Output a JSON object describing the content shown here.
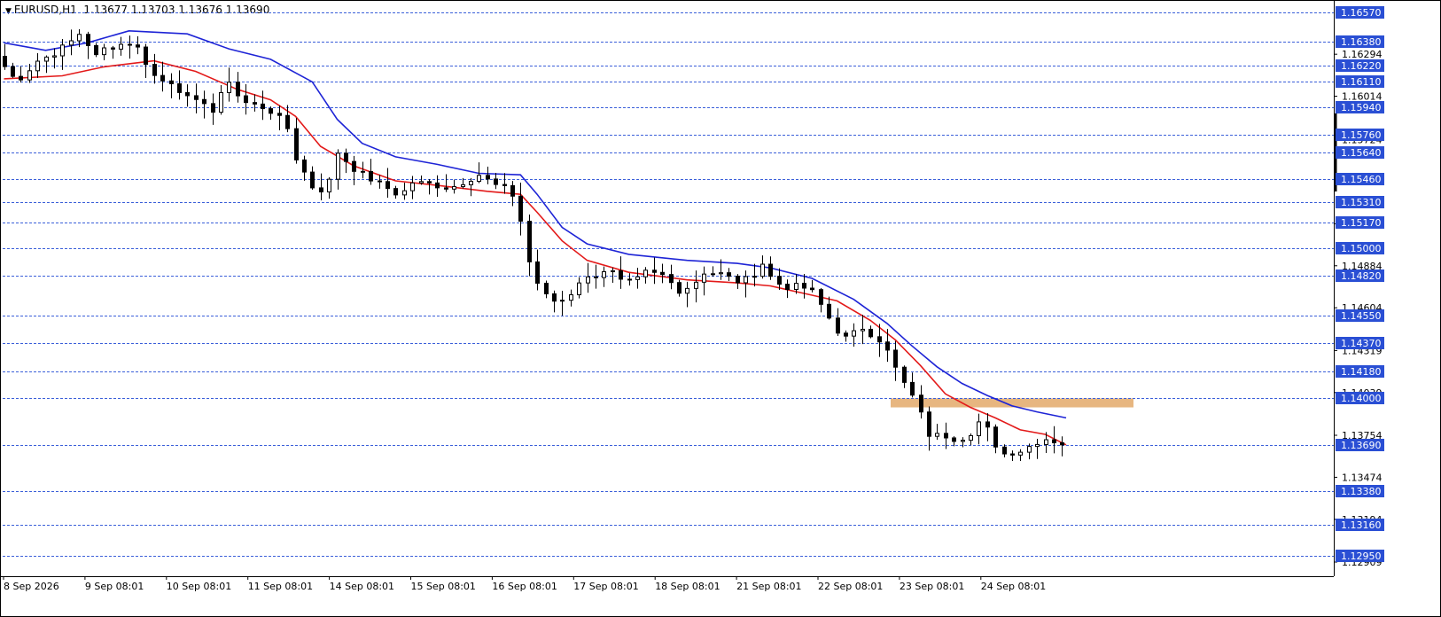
{
  "header": {
    "symbol": "EURUSD,H1",
    "ohlc": "1.13677 1.13703 1.13676 1.13690"
  },
  "colors": {
    "level_line": "#3b5fd9",
    "level_label_bg": "#2a4fd4",
    "ma_fast": "#e31a1a",
    "ma_slow": "#1e24d6",
    "candle": "#000000",
    "zone": "#e7b680"
  },
  "chart_data": {
    "type": "candlestick",
    "symbol": "EURUSD",
    "timeframe": "H1",
    "ylim": [
      1.1285,
      1.1662
    ],
    "horizontal_levels": [
      1.1657,
      1.1638,
      1.1622,
      1.1611,
      1.1594,
      1.1576,
      1.1564,
      1.1546,
      1.1531,
      1.1517,
      1.15,
      1.1482,
      1.1455,
      1.1437,
      1.1418,
      1.14,
      1.1369,
      1.1338,
      1.1316,
      1.1295
    ],
    "level_labels": [
      "1.16570",
      "1.16380",
      "1.16220",
      "1.16110",
      "1.15940",
      "1.15760",
      "1.15640",
      "1.15460",
      "1.15310",
      "1.15170",
      "1.15000",
      "1.14820",
      "1.14550",
      "1.14370",
      "1.14180",
      "1.14000",
      "1.13690",
      "1.13380",
      "1.13160",
      "1.12950"
    ],
    "price_scale_ticks": [
      {
        "value": 1.16294,
        "label": "1.16294"
      },
      {
        "value": 1.16014,
        "label": "1.16014"
      },
      {
        "value": 1.15724,
        "label": "1.15724"
      },
      {
        "value": 1.15164,
        "label": "1.15164"
      },
      {
        "value": 1.14884,
        "label": "1.14884"
      },
      {
        "value": 1.14604,
        "label": "1.14604"
      },
      {
        "value": 1.14319,
        "label": "1.14319"
      },
      {
        "value": 1.14039,
        "label": "1.14039"
      },
      {
        "value": 1.13754,
        "label": "1.13754"
      },
      {
        "value": 1.13474,
        "label": "1.13474"
      },
      {
        "value": 1.13194,
        "label": "1.13194"
      },
      {
        "value": 1.12909,
        "label": "1.12909"
      }
    ],
    "time_labels": [
      "8 Sep 2026",
      "9 Sep 08:01",
      "10 Sep 08:01",
      "11 Sep 08:01",
      "14 Sep 08:01",
      "15 Sep 08:01",
      "16 Sep 08:01",
      "17 Sep 08:01",
      "18 Sep 08:01",
      "21 Sep 08:01",
      "22 Sep 08:01",
      "23 Sep 08:01",
      "24 Sep 08:01"
    ],
    "resistance_zone": {
      "low": 1.1394,
      "high": 1.14
    },
    "price_path": [
      [
        0,
        1.1628
      ],
      [
        2.5,
        1.1611
      ],
      [
        5,
        1.1625
      ],
      [
        7,
        1.163
      ],
      [
        9,
        1.1638
      ],
      [
        10,
        1.1643
      ],
      [
        11,
        1.1636
      ],
      [
        12,
        1.1628
      ],
      [
        13,
        1.1633
      ],
      [
        15,
        1.1636
      ],
      [
        16.5,
        1.1637
      ],
      [
        17.5,
        1.163
      ],
      [
        18.5,
        1.1618
      ],
      [
        19.5,
        1.1612
      ],
      [
        21,
        1.1611
      ],
      [
        22.5,
        1.1603
      ],
      [
        23.5,
        1.1597
      ],
      [
        25,
        1.1598
      ],
      [
        26,
        1.1591
      ],
      [
        27,
        1.1602
      ],
      [
        27.8,
        1.1614
      ],
      [
        29,
        1.1602
      ],
      [
        30,
        1.1597
      ],
      [
        32,
        1.1594
      ],
      [
        33.5,
        1.159
      ],
      [
        35,
        1.158
      ],
      [
        36,
        1.156
      ],
      [
        37.5,
        1.1546
      ],
      [
        38.5,
        1.1536
      ],
      [
        40,
        1.1545
      ],
      [
        41,
        1.1564
      ],
      [
        43,
        1.1553
      ],
      [
        45,
        1.1546
      ],
      [
        47,
        1.154
      ],
      [
        48.5,
        1.1535
      ],
      [
        50,
        1.1544
      ],
      [
        52,
        1.1543
      ],
      [
        54.5,
        1.154
      ],
      [
        56,
        1.1544
      ],
      [
        58,
        1.1549
      ],
      [
        60,
        1.1542
      ],
      [
        61.5,
        1.1539
      ],
      [
        62.5,
        1.1532
      ],
      [
        64,
        1.1491
      ],
      [
        65.5,
        1.147
      ],
      [
        67,
        1.1465
      ],
      [
        68.5,
        1.1466
      ],
      [
        70,
        1.1478
      ],
      [
        72,
        1.1482
      ],
      [
        73.5,
        1.1487
      ],
      [
        75,
        1.1478
      ],
      [
        76.5,
        1.1477
      ],
      [
        78,
        1.1484
      ],
      [
        80,
        1.1482
      ],
      [
        82,
        1.1472
      ],
      [
        83.5,
        1.1475
      ],
      [
        85,
        1.1484
      ],
      [
        87,
        1.1483
      ],
      [
        89,
        1.1478
      ],
      [
        90.5,
        1.148
      ],
      [
        92,
        1.149
      ],
      [
        93,
        1.1481
      ],
      [
        94.5,
        1.1474
      ],
      [
        96.5,
        1.1475
      ],
      [
        98,
        1.1471
      ],
      [
        99.5,
        1.1458
      ],
      [
        101,
        1.1445
      ],
      [
        102.5,
        1.1438
      ],
      [
        103.5,
        1.1449
      ],
      [
        105,
        1.1443
      ],
      [
        106.5,
        1.1437
      ],
      [
        108,
        1.142
      ],
      [
        109.5,
        1.1405
      ],
      [
        111,
        1.1392
      ],
      [
        111.7,
        1.1372
      ],
      [
        113,
        1.1378
      ],
      [
        115,
        1.1373
      ],
      [
        117,
        1.1375
      ],
      [
        118.5,
        1.1387
      ],
      [
        119.5,
        1.1372
      ],
      [
        121,
        1.1363
      ],
      [
        123,
        1.1365
      ],
      [
        125,
        1.1371
      ],
      [
        126.5,
        1.1374
      ],
      [
        127.5,
        1.1369
      ]
    ],
    "series": [
      {
        "type": "ma",
        "points": [
          [
            0,
            1.1613
          ],
          [
            7,
            1.1615
          ],
          [
            12,
            1.1621
          ],
          [
            18,
            1.1625
          ],
          [
            23,
            1.1618
          ],
          [
            28,
            1.1606
          ],
          [
            32,
            1.1599
          ],
          [
            35,
            1.1588
          ],
          [
            38,
            1.1568
          ],
          [
            42,
            1.1555
          ],
          [
            47,
            1.1545
          ],
          [
            52,
            1.1542
          ],
          [
            58,
            1.1538
          ],
          [
            62,
            1.1536
          ],
          [
            64,
            1.1524
          ],
          [
            67,
            1.1505
          ],
          [
            70,
            1.1492
          ],
          [
            75,
            1.1484
          ],
          [
            82,
            1.1479
          ],
          [
            88,
            1.1477
          ],
          [
            92,
            1.1475
          ],
          [
            96,
            1.147
          ],
          [
            100,
            1.1465
          ],
          [
            104,
            1.1452
          ],
          [
            107,
            1.1439
          ],
          [
            110,
            1.1422
          ],
          [
            113,
            1.1403
          ],
          [
            116,
            1.1394
          ],
          [
            119,
            1.1387
          ],
          [
            122,
            1.1379
          ],
          [
            125,
            1.1376
          ],
          [
            127.5,
            1.1369
          ]
        ]
      },
      {
        "type": "ma",
        "points": [
          [
            0,
            1.1637
          ],
          [
            5,
            1.1632
          ],
          [
            10,
            1.1637
          ],
          [
            15,
            1.1645
          ],
          [
            22,
            1.1643
          ],
          [
            27,
            1.1633
          ],
          [
            32,
            1.1626
          ],
          [
            37,
            1.1611
          ],
          [
            40,
            1.1586
          ],
          [
            43,
            1.157
          ],
          [
            47,
            1.1561
          ],
          [
            52,
            1.1556
          ],
          [
            57,
            1.155
          ],
          [
            62,
            1.1549
          ],
          [
            64,
            1.1536
          ],
          [
            67,
            1.1514
          ],
          [
            70,
            1.1503
          ],
          [
            75,
            1.1496
          ],
          [
            82,
            1.1492
          ],
          [
            88,
            1.149
          ],
          [
            92,
            1.1487
          ],
          [
            97,
            1.148
          ],
          [
            102,
            1.1466
          ],
          [
            106,
            1.145
          ],
          [
            109,
            1.1435
          ],
          [
            112,
            1.1421
          ],
          [
            115,
            1.141
          ],
          [
            118,
            1.1402
          ],
          [
            121,
            1.1395
          ],
          [
            124,
            1.1391
          ],
          [
            127.5,
            1.1387
          ]
        ]
      }
    ]
  }
}
